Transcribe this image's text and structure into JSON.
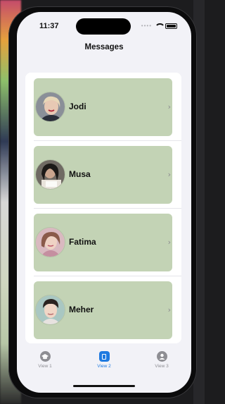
{
  "status_bar": {
    "time": "11:37"
  },
  "nav": {
    "title": "Messages"
  },
  "contacts": [
    {
      "name": "Jodi"
    },
    {
      "name": "Musa"
    },
    {
      "name": "Fatima"
    },
    {
      "name": "Meher"
    }
  ],
  "tabs": [
    {
      "label": "View 1",
      "icon": "graduation-cap-icon",
      "selected": false
    },
    {
      "label": "View 2",
      "icon": "book-icon",
      "selected": true
    },
    {
      "label": "View 3",
      "icon": "person-circle-icon",
      "selected": false
    }
  ],
  "colors": {
    "row_background": "#c3d3b5",
    "accent": "#1f7ae0",
    "inactive_tab": "#8e8e93",
    "screen_background": "#f2f2f7"
  }
}
